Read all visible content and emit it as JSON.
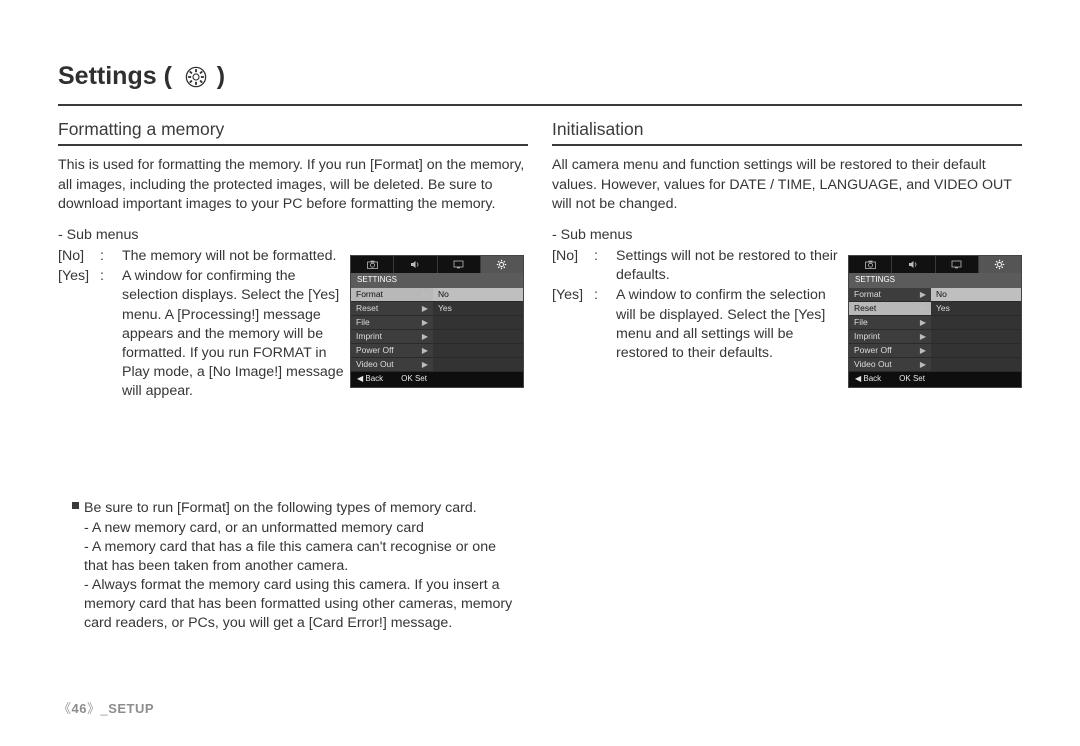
{
  "page_title_prefix": "Settings ( ",
  "page_title_suffix": " )",
  "gear_icon_name": "gear-icon",
  "left": {
    "heading": "Formatting a memory",
    "intro": "This is used for formatting the memory. If you run [Format] on the memory, all images, including the protected images, will be deleted. Be sure to download important images to your PC before formatting the memory.",
    "sub_label": "- Sub menus",
    "defs": [
      {
        "key": "[No]",
        "colon": ":",
        "txt": "The memory will not be formatted."
      },
      {
        "key": "[Yes]",
        "colon": ":",
        "txt": "A window for confirming the selection displays. Select the [Yes] menu. A [Processing!] message appears and the memory will be formatted. If you run FORMAT in Play mode, a [No Image!] message will appear."
      }
    ],
    "menu": {
      "title": "SETTINGS",
      "items": [
        "Format",
        "Reset",
        "File",
        "Imprint",
        "Power Off",
        "Video Out"
      ],
      "selected_index": 0,
      "options": [
        "No",
        "Yes"
      ],
      "option_hl_index": 0,
      "foot_back": "◀   Back",
      "foot_ok": "OK  Set"
    },
    "tips_lead": "Be sure to run [Format] on the following types of memory card.",
    "tips": [
      "- A new memory card, or an unformatted memory card",
      "- A memory card that has a file this camera can't recognise or one that has been taken from another camera.",
      "- Always format the memory card using this camera. If you insert a memory card that has been formatted using other cameras, memory card readers, or PCs, you will get a [Card Error!] message."
    ]
  },
  "right": {
    "heading": "Initialisation",
    "intro": "All camera menu and function settings will be restored to their default values. However, values for DATE / TIME, LANGUAGE, and VIDEO OUT will not be changed.",
    "sub_label": "- Sub menus",
    "defs": [
      {
        "key": "[No]",
        "colon": ":",
        "txt": "Settings will not be restored to their defaults."
      },
      {
        "key": "[Yes]",
        "colon": ":",
        "txt": "A window to confirm the selection will be displayed. Select the [Yes] menu and all settings will be restored to their defaults."
      }
    ],
    "menu": {
      "title": "SETTINGS",
      "items": [
        "Format",
        "Reset",
        "File",
        "Imprint",
        "Power Off",
        "Video Out"
      ],
      "selected_index": 1,
      "options": [
        "No",
        "Yes"
      ],
      "option_hl_index": 0,
      "foot_back": "◀   Back",
      "foot_ok": "OK  Set"
    }
  },
  "footer_page": "46",
  "footer_section": "SETUP"
}
